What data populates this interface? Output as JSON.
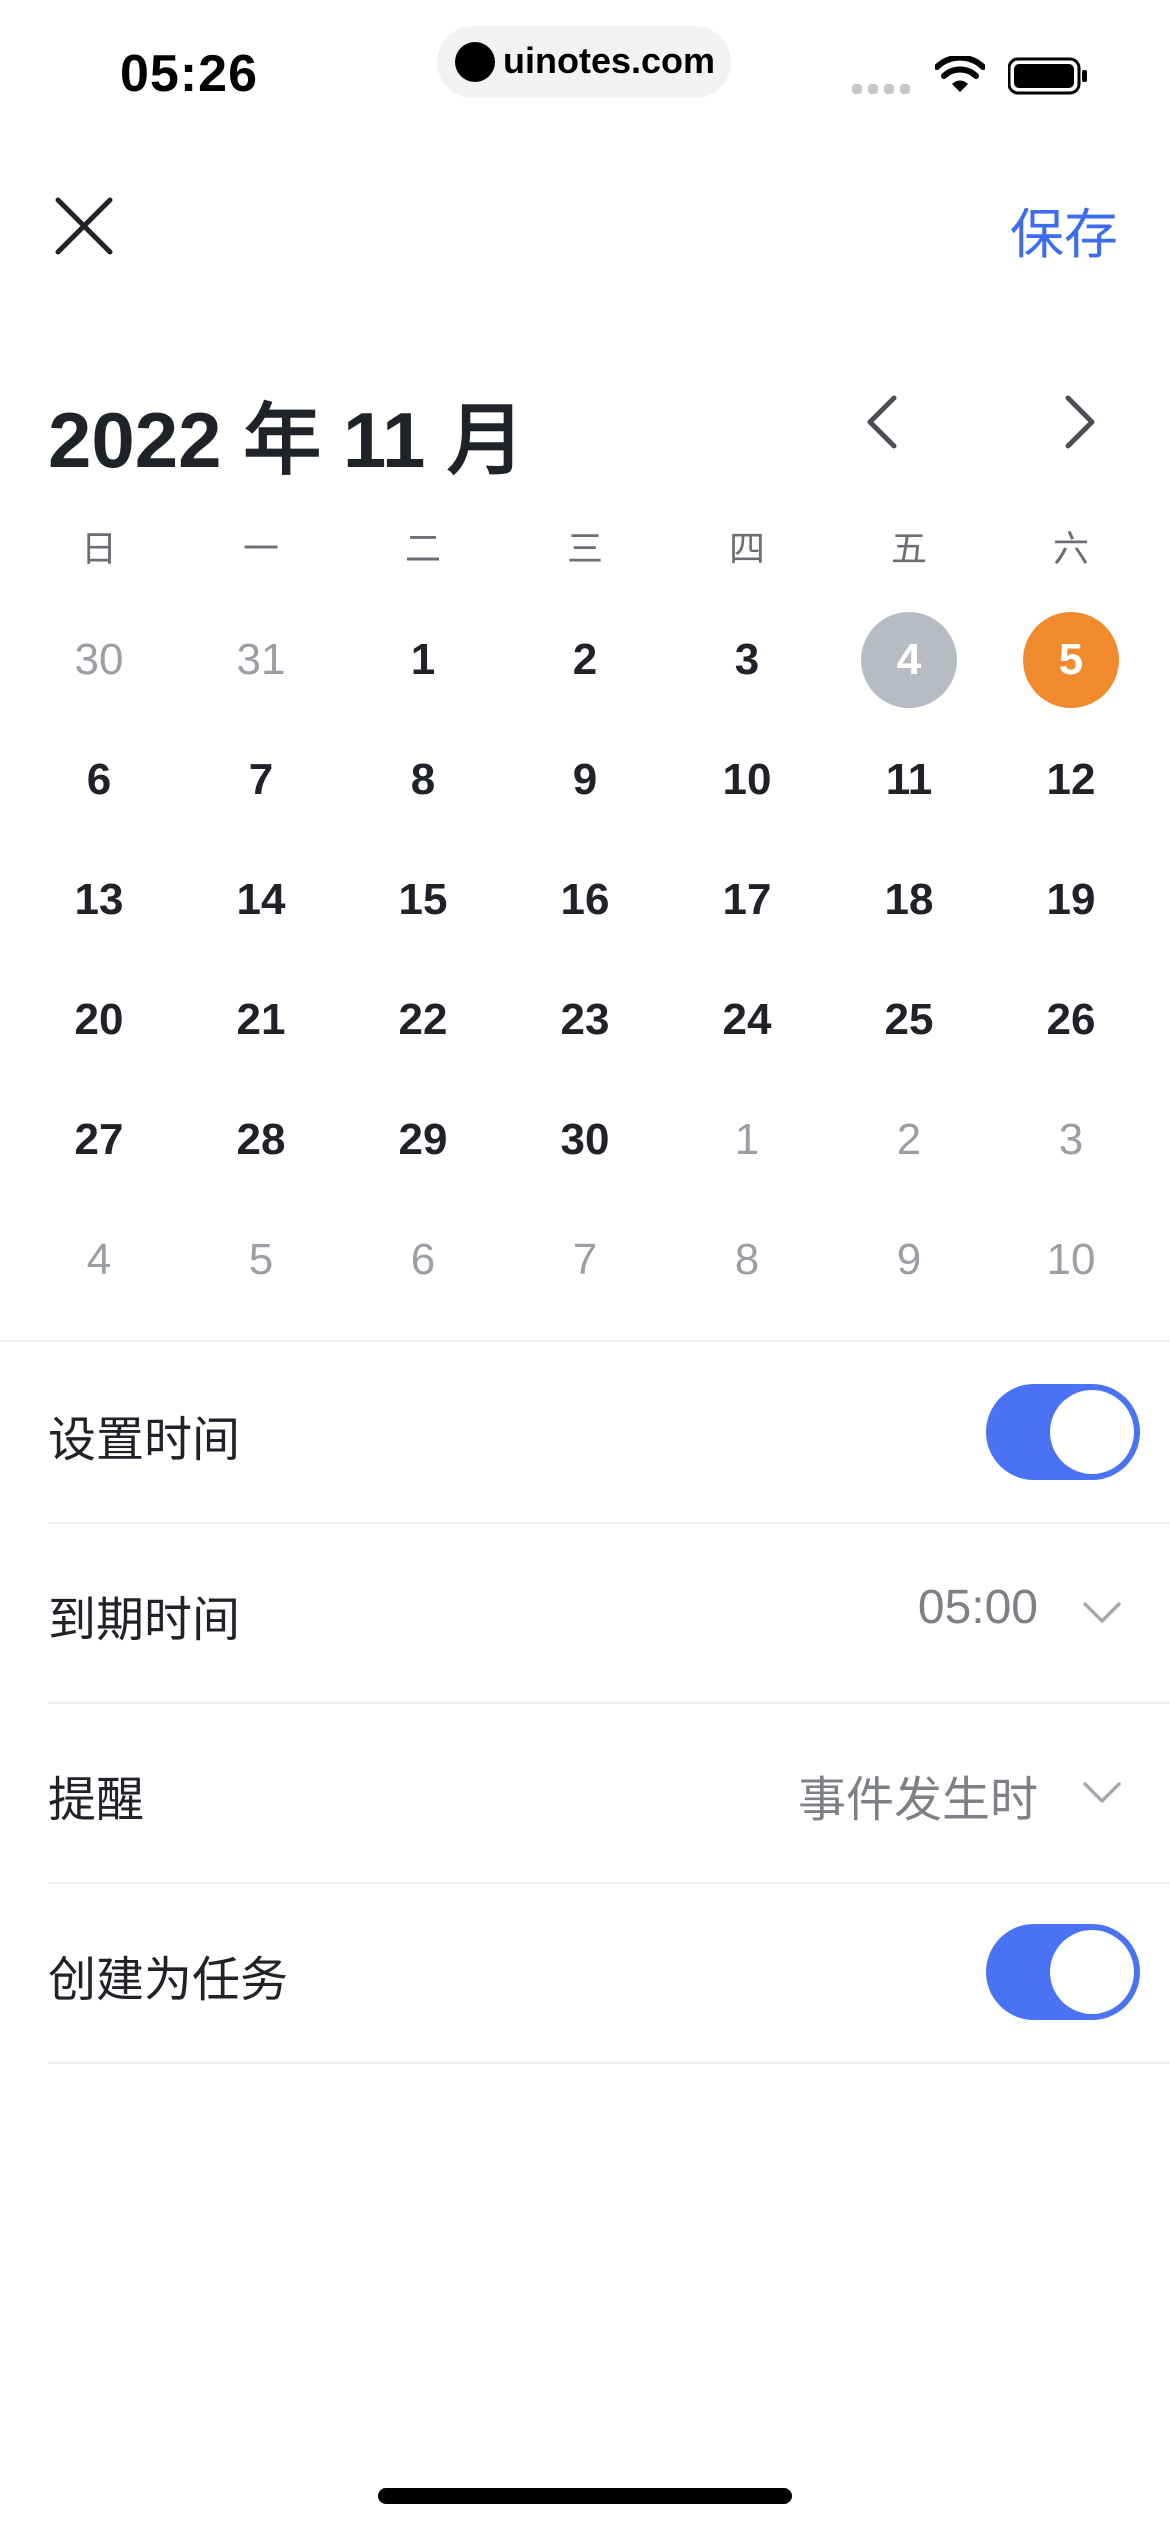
{
  "status_bar": {
    "time": "05:26",
    "url": "uinotes.com"
  },
  "header": {
    "save_label": "保存"
  },
  "calendar": {
    "month_title": "2022 年 11 月",
    "weekdays": [
      "日",
      "一",
      "二",
      "三",
      "四",
      "五",
      "六"
    ],
    "weeks": [
      [
        {
          "d": "30",
          "m": "prev"
        },
        {
          "d": "31",
          "m": "prev"
        },
        {
          "d": "1",
          "m": "cur"
        },
        {
          "d": "2",
          "m": "cur"
        },
        {
          "d": "3",
          "m": "cur"
        },
        {
          "d": "4",
          "m": "cur",
          "today": true
        },
        {
          "d": "5",
          "m": "cur",
          "selected": true
        }
      ],
      [
        {
          "d": "6",
          "m": "cur"
        },
        {
          "d": "7",
          "m": "cur"
        },
        {
          "d": "8",
          "m": "cur"
        },
        {
          "d": "9",
          "m": "cur"
        },
        {
          "d": "10",
          "m": "cur"
        },
        {
          "d": "11",
          "m": "cur"
        },
        {
          "d": "12",
          "m": "cur"
        }
      ],
      [
        {
          "d": "13",
          "m": "cur"
        },
        {
          "d": "14",
          "m": "cur"
        },
        {
          "d": "15",
          "m": "cur"
        },
        {
          "d": "16",
          "m": "cur"
        },
        {
          "d": "17",
          "m": "cur"
        },
        {
          "d": "18",
          "m": "cur"
        },
        {
          "d": "19",
          "m": "cur"
        }
      ],
      [
        {
          "d": "20",
          "m": "cur"
        },
        {
          "d": "21",
          "m": "cur"
        },
        {
          "d": "22",
          "m": "cur"
        },
        {
          "d": "23",
          "m": "cur"
        },
        {
          "d": "24",
          "m": "cur"
        },
        {
          "d": "25",
          "m": "cur"
        },
        {
          "d": "26",
          "m": "cur"
        }
      ],
      [
        {
          "d": "27",
          "m": "cur"
        },
        {
          "d": "28",
          "m": "cur"
        },
        {
          "d": "29",
          "m": "cur"
        },
        {
          "d": "30",
          "m": "cur"
        },
        {
          "d": "1",
          "m": "next"
        },
        {
          "d": "2",
          "m": "next"
        },
        {
          "d": "3",
          "m": "next"
        }
      ],
      [
        {
          "d": "4",
          "m": "next"
        },
        {
          "d": "5",
          "m": "next"
        },
        {
          "d": "6",
          "m": "next"
        },
        {
          "d": "7",
          "m": "next"
        },
        {
          "d": "8",
          "m": "next"
        },
        {
          "d": "9",
          "m": "next"
        },
        {
          "d": "10",
          "m": "next"
        }
      ]
    ]
  },
  "settings": {
    "set_time": {
      "label": "设置时间",
      "enabled": true
    },
    "due_time": {
      "label": "到期时间",
      "value": "05:00"
    },
    "reminder": {
      "label": "提醒",
      "value": "事件发生时"
    },
    "create_task": {
      "label": "创建为任务",
      "enabled": true
    }
  },
  "colors": {
    "accent": "#3c6df0",
    "toggle_on": "#4a72f5",
    "selected_day": "#f08a2c",
    "today_day": "#b8bcc2"
  }
}
